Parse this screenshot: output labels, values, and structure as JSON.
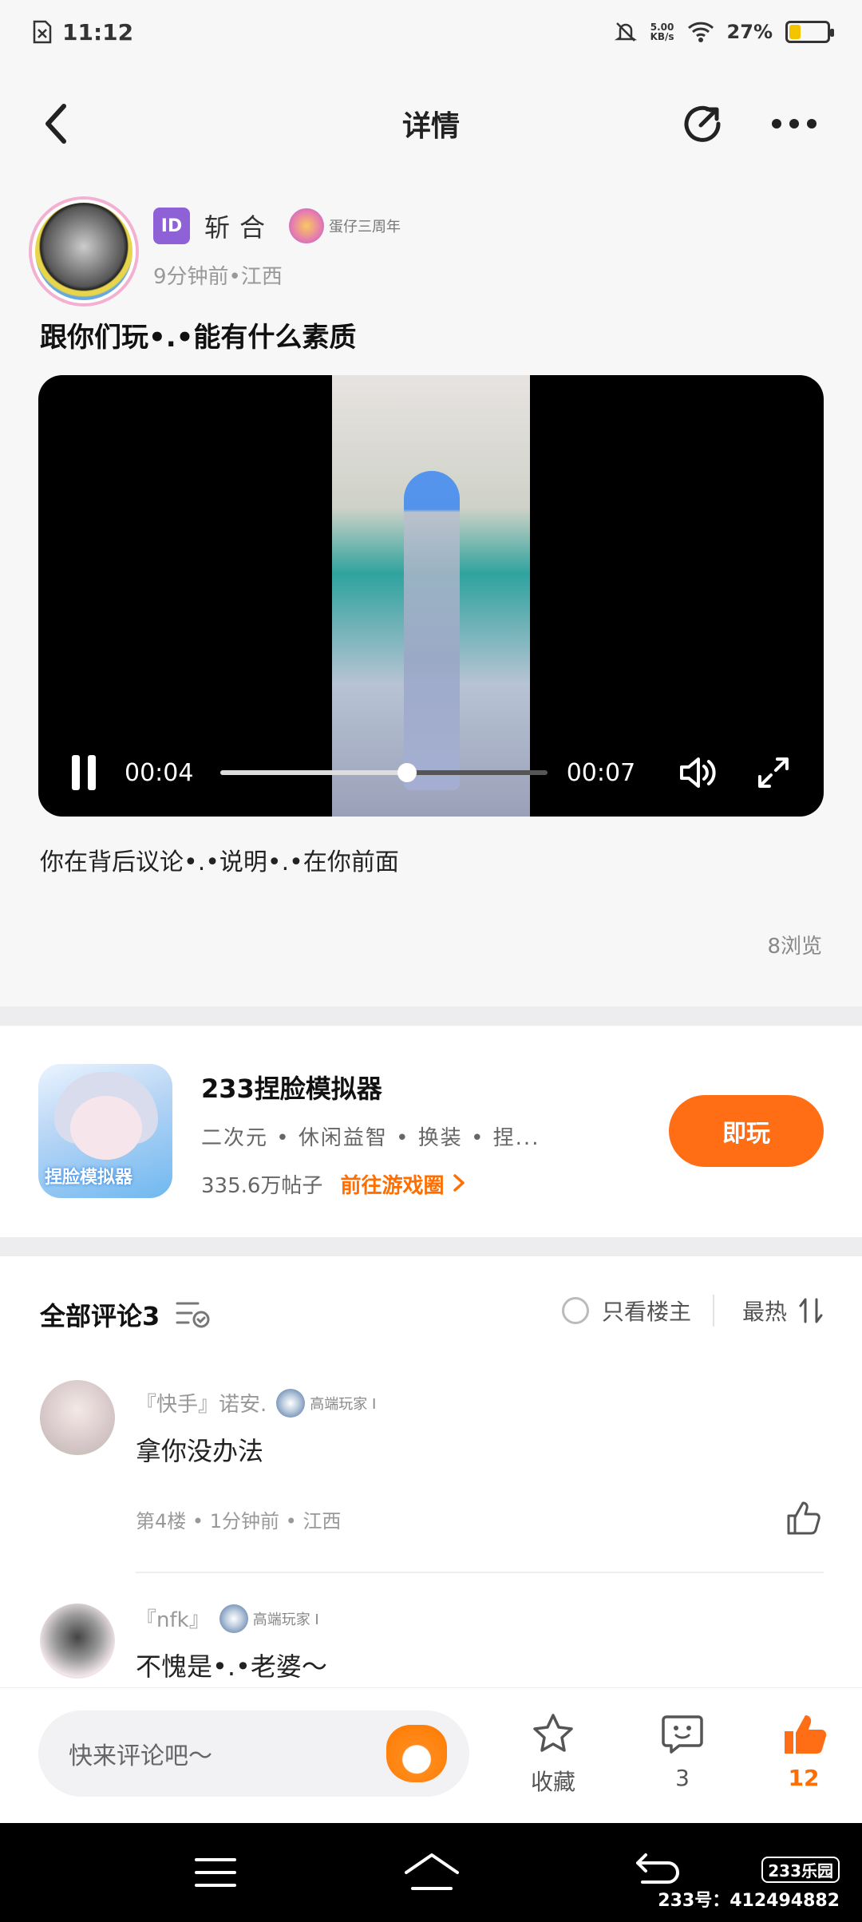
{
  "status_bar": {
    "time": "11:12",
    "net_speed_value": "5.00",
    "net_speed_unit": "KB/s",
    "battery_percent": "27%",
    "battery_level": 0.27
  },
  "header": {
    "title": "详情"
  },
  "post": {
    "author_name": "斩合",
    "author_badge_id": "ID",
    "anniversary_badge": "蛋仔三周年",
    "time": "9分钟前",
    "location": "江西",
    "title": "跟你们玩•.•能有什么素质",
    "video": {
      "current_time": "00:04",
      "total_time": "00:07",
      "progress": 0.57
    },
    "caption": "你在背后议论•.•说明•.•在你前面",
    "views": "8浏览"
  },
  "game": {
    "name": "233捏脸模拟器",
    "tags": [
      "二次元",
      "休闲益智",
      "换装",
      "捏..."
    ],
    "post_count": "335.6万帖子",
    "link_label": "前往游戏圈",
    "icon_text": "捏脸模拟器",
    "play_label": "即玩"
  },
  "comments": {
    "title": "全部评论",
    "count": "3",
    "only_op_label": "只看楼主",
    "sort_label": "最热",
    "items": [
      {
        "nick": "『快手』诺安.",
        "badge": "高端玩家 I",
        "text": "拿你没办法",
        "floor": "第4楼",
        "time": "1分钟前",
        "location": "江西"
      },
      {
        "nick": "『nfk』",
        "badge": "高端玩家 I",
        "text": "不愧是•.•老婆～"
      }
    ]
  },
  "bottom_bar": {
    "comment_placeholder": "快来评论吧～",
    "favorite_label": "收藏",
    "comment_count": "3",
    "like_count": "12"
  },
  "watermark": {
    "logo": "233乐园",
    "id_text": "233号：412494882"
  },
  "colors": {
    "accent": "#ff6e14",
    "id_badge": "#8e62d6"
  }
}
